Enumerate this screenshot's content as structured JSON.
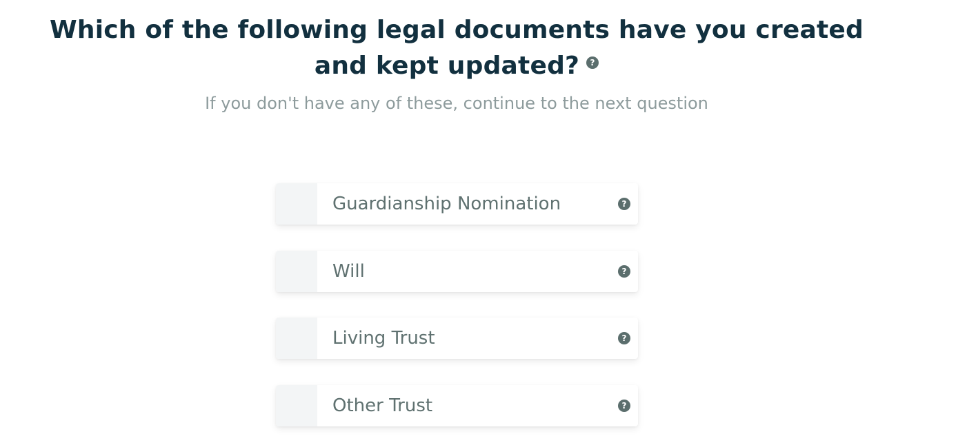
{
  "question": {
    "title": "Which of the following legal documents have you created and kept updated?",
    "help_icon": "question-circle-icon",
    "subtitle": "If you don't have any of these, continue to the next question"
  },
  "options": [
    {
      "label": "Guardianship Nomination",
      "checked": false,
      "help_icon": "question-circle-icon"
    },
    {
      "label": "Will",
      "checked": false,
      "help_icon": "question-circle-icon"
    },
    {
      "label": "Living Trust",
      "checked": false,
      "help_icon": "question-circle-icon"
    },
    {
      "label": "Other Trust",
      "checked": false,
      "help_icon": "question-circle-icon"
    }
  ],
  "colors": {
    "title": "#12303f",
    "subtitle": "#8d9b9c",
    "option_text": "#5f7170",
    "icon": "#5b6e6d",
    "checkbox_bg": "#f3f5f6"
  }
}
